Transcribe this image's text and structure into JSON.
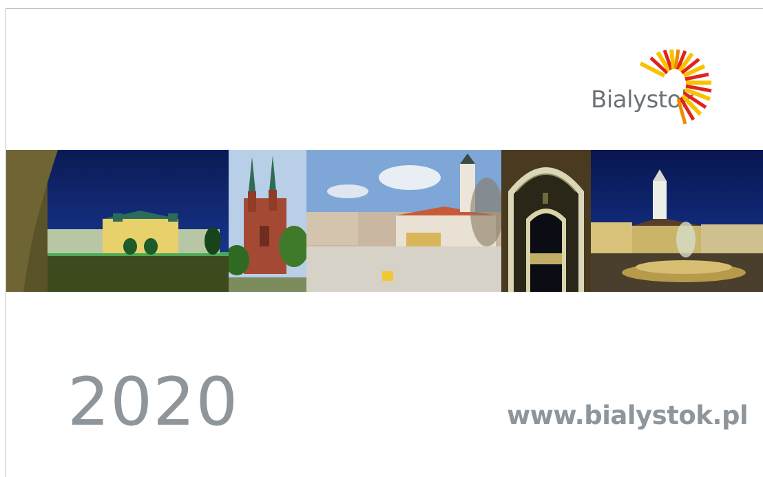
{
  "brand": {
    "name": "Bialystok"
  },
  "photos": [
    {
      "subject": "palace-at-night"
    },
    {
      "subject": "red-brick-cathedral"
    },
    {
      "subject": "town-square"
    },
    {
      "subject": "arched-gateway-at-night"
    },
    {
      "subject": "town-hall-fountain-at-night"
    }
  ],
  "year": "2020",
  "website": "www.bialystok.pl",
  "colors": {
    "text_gray": "#8e969c",
    "logo_gray": "#6b7278",
    "ray_yellow": "#f7c300",
    "ray_red": "#e2231a",
    "ray_orange": "#f08a00"
  }
}
